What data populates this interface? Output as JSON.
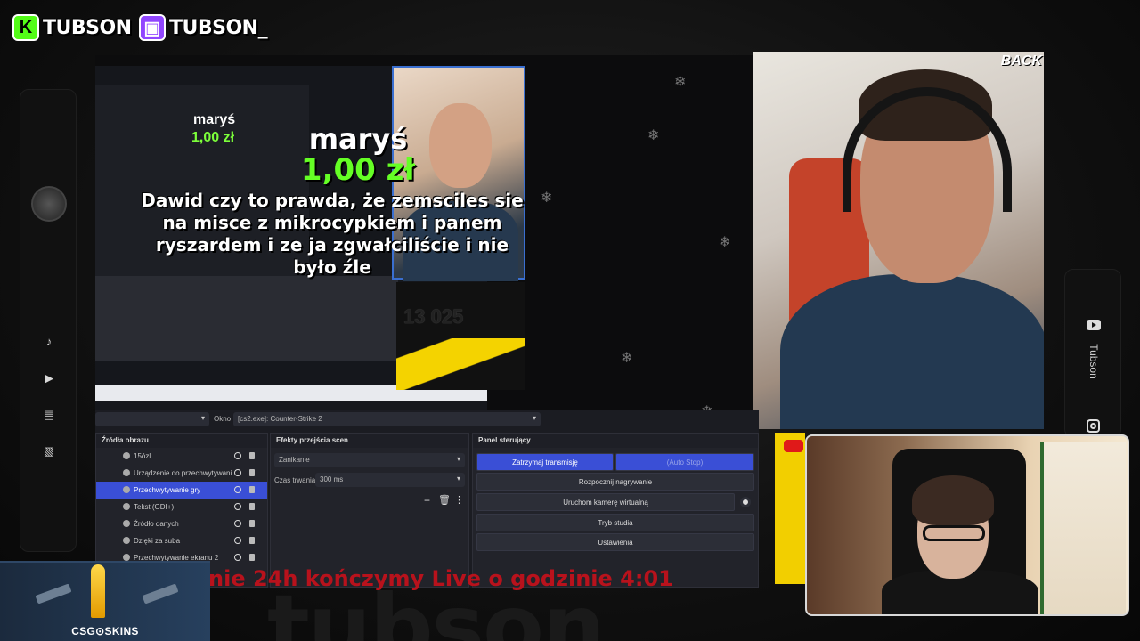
{
  "header": {
    "kick": {
      "logo": "K",
      "handle": "TUBSON"
    },
    "twitch": {
      "logo": "▣",
      "handle": "TUBSON_"
    }
  },
  "sidebar": {
    "items": [
      {
        "icon": "music-note-icon",
        "glyph": "♪"
      },
      {
        "icon": "play-icon",
        "glyph": "▶"
      },
      {
        "icon": "clapperboard-icon",
        "glyph": "▤"
      },
      {
        "icon": "image-icon",
        "glyph": "▧"
      }
    ]
  },
  "right_rail": {
    "channel_label": "Tubson"
  },
  "stream_alert": {
    "donor": "maryś",
    "amount": "1,00 zł",
    "message": "Dawid czy to prawda, że zemsciles sie na misce z mikrocypkiem i panem ryszardem i ze ja zgwałciliście i nie było źle",
    "mini_donor": "maryś",
    "mini_amount": "1,00 zł",
    "sub_counter": "13 025"
  },
  "webcam": {
    "corner_text": "BACK"
  },
  "obs": {
    "source_dropdown_value": "",
    "window_label": "Okno",
    "window_value": "[cs2.exe]: Counter-Strike 2",
    "sources_panel": {
      "title": "Źródła obrazu",
      "items": [
        {
          "label": "15ózl",
          "selected": false
        },
        {
          "label": "Urządzenie do przechwytywani",
          "selected": false
        },
        {
          "label": "Przechwytywanie gry",
          "selected": true
        },
        {
          "label": "Tekst (GDI+)",
          "selected": false
        },
        {
          "label": "Źródło danych",
          "selected": false
        },
        {
          "label": "Dzięki za suba",
          "selected": false
        },
        {
          "label": "Przechwytywanie ekranu 2",
          "selected": false
        }
      ]
    },
    "transitions_panel": {
      "title": "Efekty przejścia scen",
      "transition_value": "Zanikanie",
      "duration_label": "Czas trwania",
      "duration_value": "300 ms"
    },
    "controls_panel": {
      "title": "Panel sterujący",
      "stop_stream": "Zatrzymaj transmisję",
      "auto_stop": "(Auto Stop)",
      "start_recording": "Rozpocznij nagrywanie",
      "virtual_camera": "Uruchom kamerę wirtualną",
      "studio_mode": "Tryb studia",
      "settings": "Ustawienia"
    }
  },
  "ticker": {
    "text": "nie 24h kończymy Live o godzinie 4:01"
  },
  "brand_watermark": "tubson",
  "sponsor": {
    "label": "CSG⊙SKINS"
  },
  "colors": {
    "kick_green": "#53fc18",
    "twitch_purple": "#9146ff",
    "obs_selected_blue": "#3a4fd6",
    "alert_amount_green": "#65ff25",
    "ticker_red": "#b8121c"
  }
}
